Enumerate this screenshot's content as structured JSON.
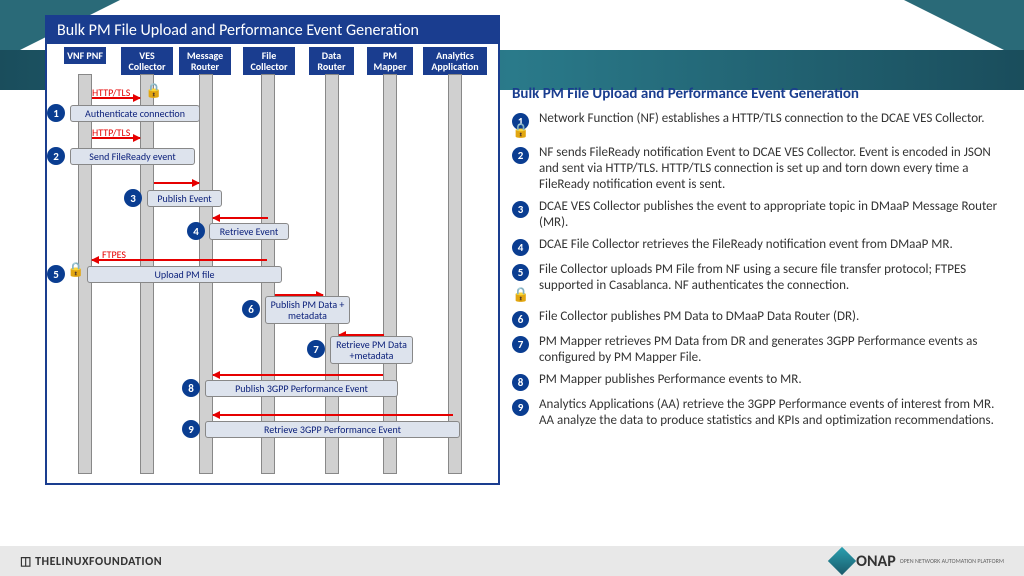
{
  "diagram": {
    "title": "Bulk PM File Upload and Performance Event Generation",
    "lanes": [
      "VNF PNF",
      "VES Collector",
      "Message Router",
      "File Collector",
      "Data Router",
      "PM Mapper",
      "Analytics Application"
    ],
    "protocols": {
      "http": "HTTP/TLS",
      "ftpes": "FTPES"
    },
    "messages": {
      "m1": "Authenticate connection",
      "m2": "Send FileReady event",
      "m3": "Publish Event",
      "m4": "Retrieve Event",
      "m5": "Upload PM file",
      "m6": "Publish PM Data + metadata",
      "m7": "Retrieve PM Data +metadata",
      "m8": "Publish 3GPP Performance Event",
      "m9": "Retrieve 3GPP Performance Event"
    }
  },
  "description": {
    "title": "Bulk PM File Upload and Performance Event Generation",
    "steps": [
      "Network Function (NF) establishes a HTTP/TLS connection to the DCAE VES Collector.",
      "NF sends FileReady notification Event to DCAE VES Collector. Event is encoded in JSON and sent via HTTP/TLS.  HTTP/TLS connection is set up and torn down every time a FileReady notification event is sent.",
      "DCAE VES Collector publishes the event to appropriate topic in DMaaP Message Router (MR).",
      "DCAE File Collector retrieves the FileReady notification event from DMaaP MR.",
      "File Collector uploads PM File from NF using a secure file transfer protocol; FTPES supported in Casablanca.  NF authenticates the connection.",
      "File Collector publishes PM Data to DMaaP Data Router (DR).",
      "PM Mapper retrieves PM Data from DR and generates 3GPP Performance events as configured by PM Mapper File.",
      "PM Mapper publishes Performance events to MR.",
      "Analytics Applications (AA) retrieve the 3GPP Performance events of interest from MR.  AA analyze the data to produce statistics and KPIs and optimization recommendations."
    ]
  },
  "footer": {
    "linux": "THELINUXFOUNDATION",
    "onap": "ONAP",
    "onap_sub": "OPEN NETWORK AUTOMATION PLATFORM"
  }
}
